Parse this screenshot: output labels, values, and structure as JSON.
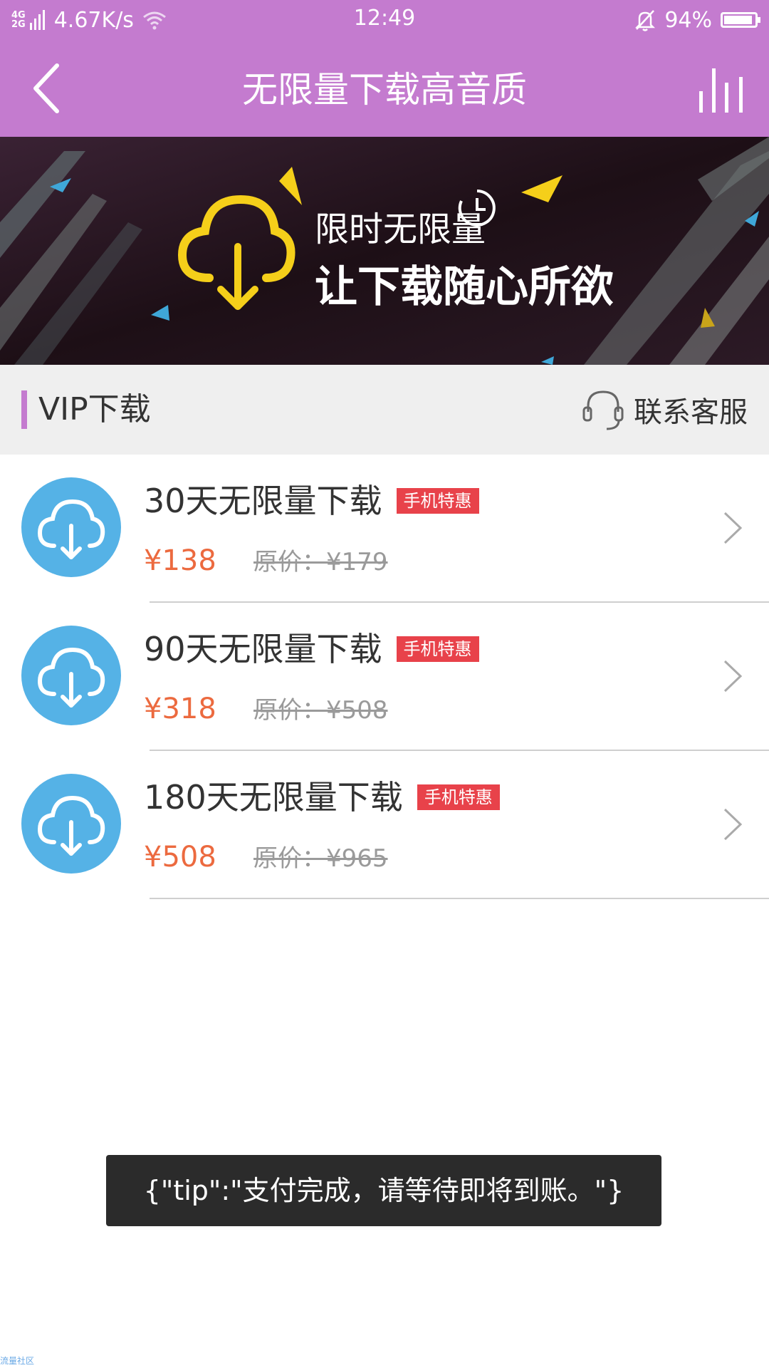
{
  "status_bar": {
    "network_top": "4G",
    "network_bottom": "2G",
    "speed": "4.67K/s",
    "time": "12:49",
    "battery": "94%",
    "battery_level": 0.94
  },
  "header": {
    "title": "无限量下载高音质",
    "back_icon": "chevron-left-icon",
    "menu_icon": "equalizer-icon"
  },
  "banner": {
    "line1": "限时无限量",
    "line2": "让下载随心所欲",
    "icon": "cloud-download-icon"
  },
  "section": {
    "title": "VIP下载",
    "contact_label": "联系客服",
    "contact_icon": "headset-icon"
  },
  "plans": [
    {
      "name": "30天无限量下载",
      "badge": "手机特惠",
      "price": "¥138",
      "original": "原价：¥179"
    },
    {
      "name": "90天无限量下载",
      "badge": "手机特惠",
      "price": "¥318",
      "original": "原价：¥508"
    },
    {
      "name": "180天无限量下载",
      "badge": "手机特惠",
      "price": "¥508",
      "original": "原价：¥965"
    }
  ],
  "toast": {
    "text": "{\"tip\":\"支付完成，请等待即将到账。\"}"
  },
  "watermark": "流量社区",
  "colors": {
    "brand": "#c47bcf",
    "icon_blue": "#55b2e6",
    "price": "#ec6a3f",
    "badge": "#e8424a",
    "banner_yellow": "#f5cf1a"
  }
}
